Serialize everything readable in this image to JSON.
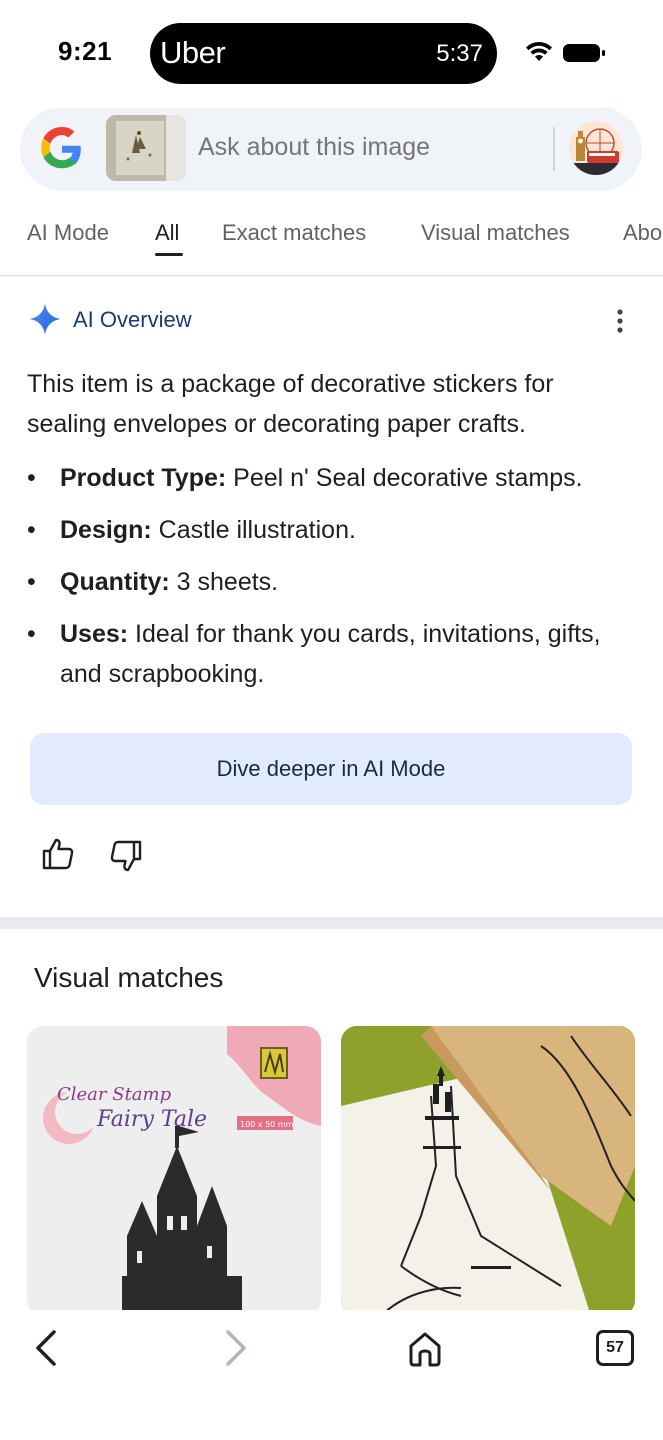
{
  "status_bar": {
    "time": "9:21",
    "live_activity_app": "Uber",
    "live_activity_timer": "5:37",
    "icons": [
      "wifi-icon",
      "battery-icon"
    ]
  },
  "search": {
    "placeholder": "Ask about this image",
    "logo_icon": "google-g-icon",
    "avatar_icon": "profile-avatar"
  },
  "tabs": [
    {
      "label": "AI Mode",
      "active": false
    },
    {
      "label": "All",
      "active": true
    },
    {
      "label": "Exact matches",
      "active": false
    },
    {
      "label": "Visual matches",
      "active": false
    },
    {
      "label": "Abo",
      "active": false
    }
  ],
  "ai_overview": {
    "title": "AI Overview",
    "summary": "This item is a package of decorative stickers for sealing envelopes or decorating paper crafts.",
    "items": [
      {
        "label": "Product Type:",
        "text": " Peel n' Seal decorative stamps."
      },
      {
        "label": "Design:",
        "text": " Castle illustration."
      },
      {
        "label": "Quantity:",
        "text": " 3 sheets."
      },
      {
        "label": "Uses:",
        "text": " Ideal for thank you cards, invitations, gifts, and scrapbooking."
      }
    ],
    "dive_button": "Dive deeper in AI Mode",
    "feedback_icons": [
      "thumbs-up-icon",
      "thumbs-down-icon"
    ]
  },
  "visual_matches": {
    "title": "Visual matches",
    "cards": [
      {
        "brand_line1": "Clear Stamp",
        "brand_line2": "Fairy Tale",
        "size": "100 x 50 mm"
      },
      {}
    ]
  },
  "bottom_nav": {
    "tab_count": "57",
    "icons": [
      "back-icon",
      "forward-icon",
      "home-icon",
      "tabs-icon"
    ]
  },
  "colors": {
    "accent_blue": "#1a73e8",
    "dive_button_bg": "#e2ebfb",
    "search_bg": "#f0f3f8"
  }
}
